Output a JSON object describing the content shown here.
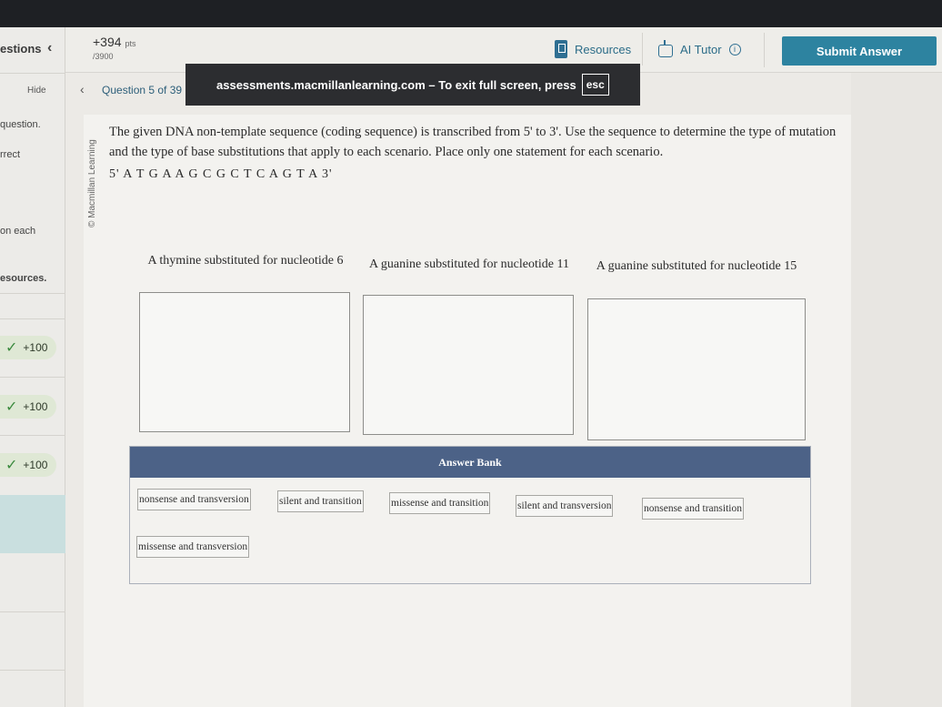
{
  "sidebar": {
    "header": "estions",
    "hide": "Hide",
    "snippets": [
      "question.",
      "rrect",
      "on each",
      "esources."
    ],
    "badges": [
      "+100",
      "+100",
      "+100"
    ]
  },
  "topbar": {
    "points": "+394",
    "points_unit": "pts",
    "points_total": "/3900",
    "resources_label": "Resources",
    "ai_tutor_label": "AI Tutor",
    "submit_label": "Submit Answer"
  },
  "nav": {
    "question_label": "Question 5 of 39"
  },
  "banner": {
    "text": "assessments.macmillanlearning.com – To exit full screen, press",
    "key": "esc"
  },
  "question": {
    "copyright": "© Macmillan Learning",
    "prompt": "The given DNA non-template sequence (coding sequence) is transcribed from 5' to 3'. Use the sequence to determine the type of mutation and the type of base substitutions that apply to each scenario. Place only one statement for each scenario.",
    "sequence": "5' A T G A A G C G C T C A G T A 3'"
  },
  "scenarios": [
    {
      "label": "A thymine substituted for nucleotide 6"
    },
    {
      "label": "A guanine substituted for nucleotide 11"
    },
    {
      "label": "A guanine substituted for nucleotide 15"
    }
  ],
  "answer_bank": {
    "title": "Answer Bank",
    "options": [
      "nonsense and transversion",
      "silent and transition",
      "missense and transition",
      "silent and transversion",
      "nonsense and transition",
      "missense and transversion"
    ]
  }
}
